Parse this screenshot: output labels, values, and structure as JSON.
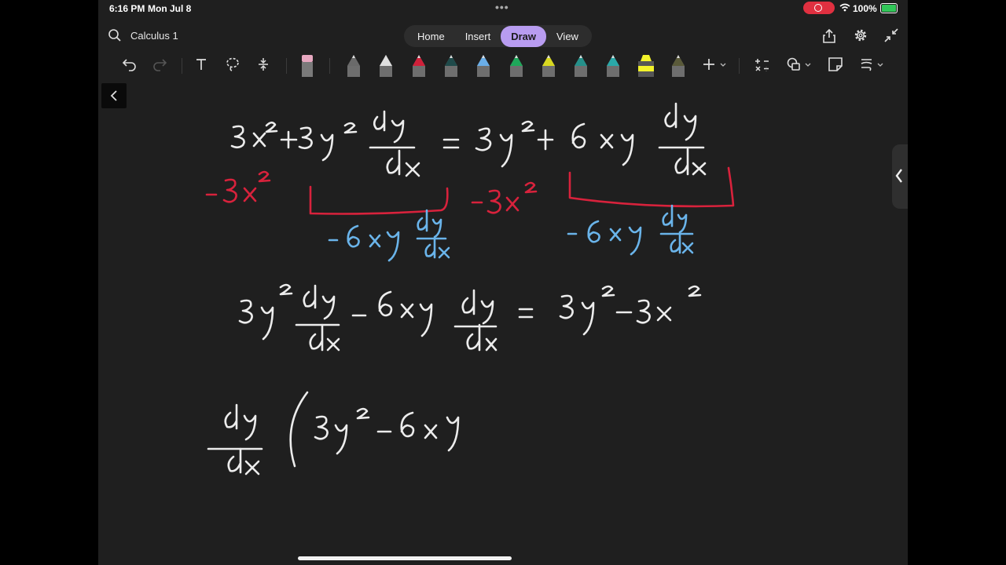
{
  "status": {
    "time": "6:16 PM",
    "date": "Mon Jul 8",
    "battery": "100%"
  },
  "header": {
    "doc_title": "Calculus 1"
  },
  "tabs": [
    {
      "label": "Home",
      "active": false
    },
    {
      "label": "Insert",
      "active": false
    },
    {
      "label": "Draw",
      "active": true
    },
    {
      "label": "View",
      "active": false
    }
  ],
  "toolbar": {
    "pens": [
      {
        "name": "pencil-tool",
        "color": "#6a6a6a"
      },
      {
        "name": "pen-white",
        "color": "#e0e0e0"
      },
      {
        "name": "pen-red",
        "color": "#d0203a"
      },
      {
        "name": "pen-dark-teal",
        "color": "#1f4a4a"
      },
      {
        "name": "pen-light-blue",
        "color": "#6aaee8"
      },
      {
        "name": "pen-green",
        "color": "#1fa85a"
      },
      {
        "name": "pen-yellow",
        "color": "#d8d820"
      },
      {
        "name": "pen-teal",
        "color": "#25908a"
      },
      {
        "name": "pen-cyan",
        "color": "#2aa8a8"
      },
      {
        "name": "highlighter-yellow",
        "color": "#f2f22a"
      },
      {
        "name": "pen-olive",
        "color": "#5a5a3a"
      }
    ]
  },
  "colors": {
    "ink_white": "#ececec",
    "ink_red": "#d8223c",
    "ink_blue": "#6ab4ea",
    "accent": "#b89cf0"
  }
}
